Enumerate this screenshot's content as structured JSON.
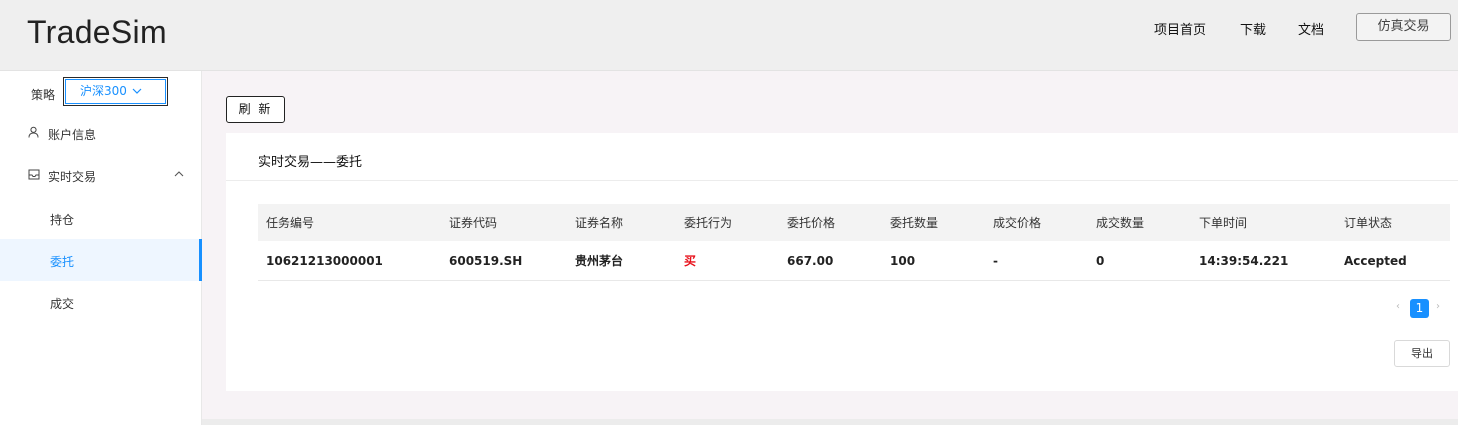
{
  "header": {
    "logo": "TradeSim",
    "nav": [
      "项目首页",
      "下载",
      "文档"
    ],
    "sim_button": "仿真交易"
  },
  "sidebar": {
    "strategy_label": "策略",
    "strategy_value": "沪深300",
    "account_info": "账户信息",
    "realtime_trade": "实时交易",
    "sub_items": [
      "持仓",
      "委托",
      "成交"
    ],
    "active_sub_item": "委托"
  },
  "main": {
    "refresh_button": "刷 新",
    "card_title": "实时交易——委托",
    "table": {
      "columns": [
        "任务编号",
        "证券代码",
        "证券名称",
        "委托行为",
        "委托价格",
        "委托数量",
        "成交价格",
        "成交数量",
        "下单时间",
        "订单状态"
      ],
      "rows": [
        [
          "10621213000001",
          "600519.SH",
          "贵州茅台",
          "买",
          "667.00",
          "100",
          "-",
          "0",
          "14:39:54.221",
          "Accepted"
        ]
      ]
    },
    "pagination": {
      "current_page": "1"
    },
    "export_button": "导出"
  },
  "colors": {
    "accent": "#1890ff",
    "buy": "#e8101a"
  }
}
